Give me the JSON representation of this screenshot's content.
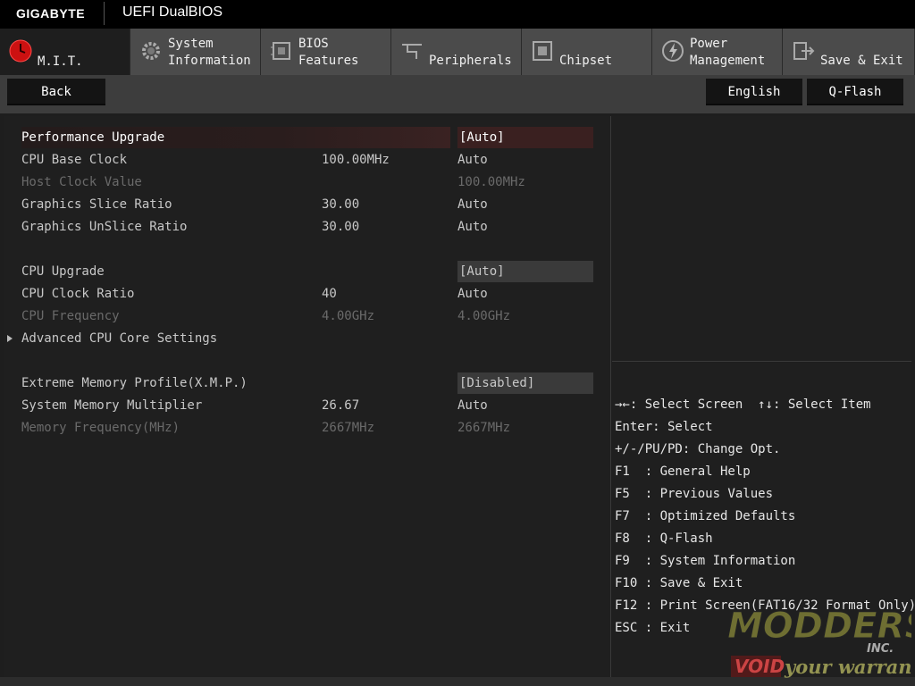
{
  "header": {
    "brand": "GIGABYTE",
    "product": "UEFI DualBIOS"
  },
  "tabs": [
    {
      "line1": "",
      "line2": "M.I.T.",
      "icon": "mit-icon",
      "active": true
    },
    {
      "line1": "System",
      "line2": "Information",
      "icon": "gear-icon"
    },
    {
      "line1": "BIOS",
      "line2": "Features",
      "icon": "bios-chip-icon"
    },
    {
      "line1": "",
      "line2": "Peripherals",
      "icon": "peripherals-icon"
    },
    {
      "line1": "",
      "line2": "Chipset",
      "icon": "chipset-icon"
    },
    {
      "line1": "Power",
      "line2": "Management",
      "icon": "power-icon"
    },
    {
      "line1": "",
      "line2": "Save & Exit",
      "icon": "exit-icon"
    }
  ],
  "buttons": {
    "back": "Back",
    "language": "English",
    "qflash": "Q-Flash"
  },
  "settings": [
    {
      "label": "Performance Upgrade",
      "current": "",
      "option": "[Auto]",
      "style": "selected"
    },
    {
      "label": "CPU Base Clock",
      "current": "100.00MHz",
      "option": "Auto",
      "style": "normal"
    },
    {
      "label": "Host Clock Value",
      "current": "",
      "option": "100.00MHz",
      "style": "dim"
    },
    {
      "label": "Graphics Slice Ratio",
      "current": "30.00",
      "option": "Auto",
      "style": "normal"
    },
    {
      "label": "Graphics UnSlice Ratio",
      "current": "30.00",
      "option": "Auto",
      "style": "normal"
    },
    {
      "label": "CPU Upgrade",
      "current": "",
      "option": "[Auto]",
      "style": "box"
    },
    {
      "label": "CPU Clock Ratio",
      "current": "40",
      "option": "Auto",
      "style": "normal"
    },
    {
      "label": "CPU Frequency",
      "current": "4.00GHz",
      "option": "4.00GHz",
      "style": "dim"
    },
    {
      "label": "Advanced CPU Core Settings",
      "current": "",
      "option": "",
      "style": "submenu"
    },
    {
      "label": "Extreme Memory Profile(X.M.P.)",
      "current": "",
      "option": "[Disabled]",
      "style": "box"
    },
    {
      "label": "System Memory Multiplier",
      "current": "26.67",
      "option": "Auto",
      "style": "normal"
    },
    {
      "label": "Memory Frequency(MHz)",
      "current": "2667MHz",
      "option": "2667MHz",
      "style": "dim"
    }
  ],
  "help": [
    "→←: Select Screen  ↑↓: Select Item",
    "Enter: Select",
    "+/-/PU/PD: Change Opt.",
    "F1  : General Help",
    "F5  : Previous Values",
    "F7  : Optimized Defaults",
    "F8  : Q-Flash",
    "F9  : System Information",
    "F10 : Save & Exit",
    "F12 : Print Screen(FAT16/32 Format Only)",
    "ESC : Exit"
  ],
  "watermark": {
    "line1": "MODDERS",
    "line2": "INC.",
    "line3": "VOID",
    "line4": "your warranty"
  },
  "colors": {
    "accent_red": "#cc1111",
    "selected_row": "#3a2020",
    "tab_inactive": "#4b4b4b"
  }
}
